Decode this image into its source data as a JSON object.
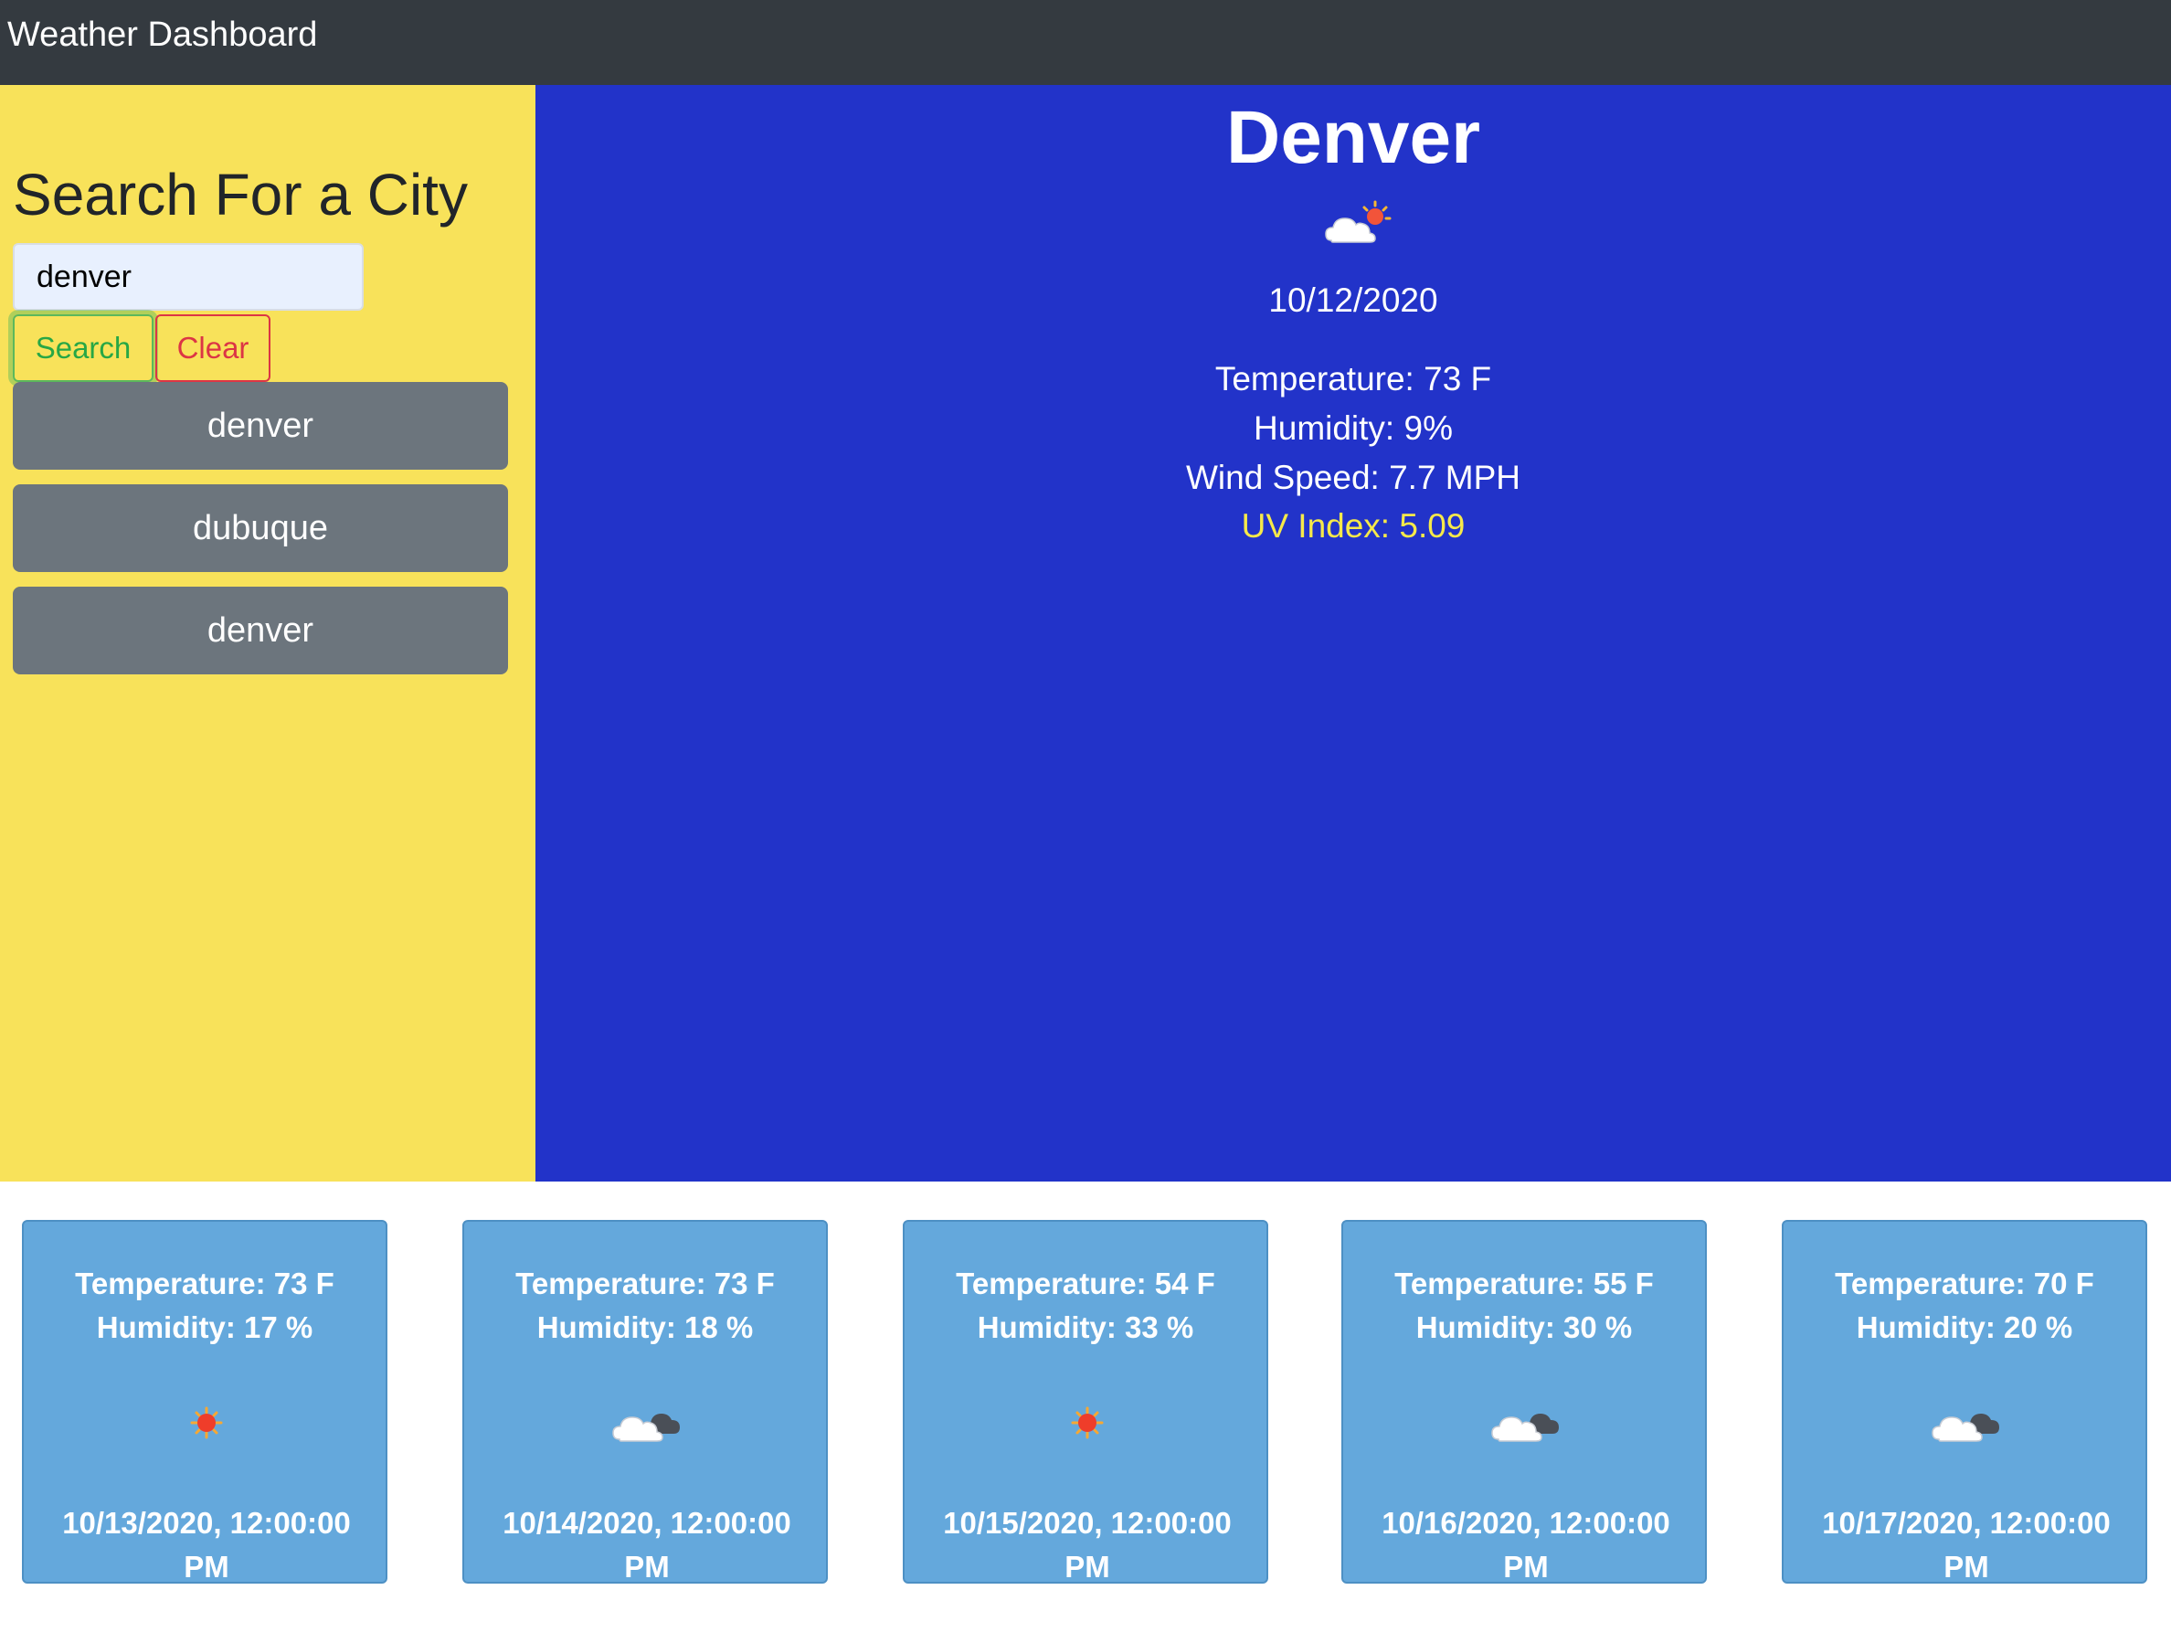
{
  "navbar": {
    "brand": "Weather Dashboard"
  },
  "sidebar": {
    "heading": "Search For a City",
    "search_value": "denver",
    "search_label": "Search",
    "clear_label": "Clear",
    "history": [
      "denver",
      "dubuque",
      "denver"
    ]
  },
  "current": {
    "city": "Denver",
    "icon": "partly-cloudy-icon",
    "date": "10/12/2020",
    "temperature": "Temperature: 73 F",
    "humidity": "Humidity: 9%",
    "wind": "Wind Speed: 7.7 MPH",
    "uv": "UV Index: 5.09"
  },
  "forecast": [
    {
      "temperature": "Temperature: 73 F",
      "humidity": "Humidity: 17 %",
      "icon": "sun-icon",
      "date": "10/13/2020, 12:00:00 PM"
    },
    {
      "temperature": "Temperature: 73 F",
      "humidity": "Humidity: 18 %",
      "icon": "cloud-icon",
      "date": "10/14/2020, 12:00:00 PM"
    },
    {
      "temperature": "Temperature: 54 F",
      "humidity": "Humidity: 33 %",
      "icon": "sun-icon",
      "date": "10/15/2020, 12:00:00 PM"
    },
    {
      "temperature": "Temperature: 55 F",
      "humidity": "Humidity: 30 %",
      "icon": "cloud-icon",
      "date": "10/16/2020, 12:00:00 PM"
    },
    {
      "temperature": "Temperature: 70 F",
      "humidity": "Humidity: 20 %",
      "icon": "cloud-icon",
      "date": "10/17/2020, 12:00:00 PM"
    }
  ],
  "colors": {
    "navbar": "#343a40",
    "sidebar": "#f8e25a",
    "main": "#2233c9",
    "card": "#64a8dc",
    "uv_text": "#f6e94a",
    "history_button": "#6c757d"
  }
}
